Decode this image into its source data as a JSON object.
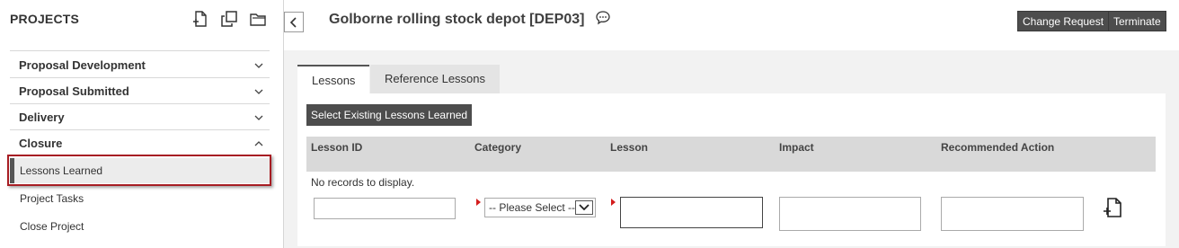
{
  "sidebar": {
    "header": "PROJECTS",
    "tools": [
      "new-page-icon",
      "copy-icon",
      "folder-icon"
    ],
    "sections": [
      {
        "label": "Proposal Development",
        "state": "collapsed"
      },
      {
        "label": "Proposal Submitted",
        "state": "collapsed"
      },
      {
        "label": "Delivery",
        "state": "collapsed"
      },
      {
        "label": "Closure",
        "state": "expanded"
      }
    ],
    "closure_items": [
      {
        "label": "Lessons Learned",
        "active": true
      },
      {
        "label": "Project Tasks",
        "active": false
      },
      {
        "label": "Close Project",
        "active": false
      }
    ]
  },
  "header": {
    "title": "Golborne rolling stock depot [DEP03]",
    "buttons": {
      "change_request": "Change Request",
      "terminate": "Terminate"
    }
  },
  "tabs": [
    {
      "label": "Lessons",
      "active": true
    },
    {
      "label": "Reference Lessons",
      "active": false
    }
  ],
  "panel": {
    "select_button": "Select Existing Lessons Learned",
    "columns": [
      "Lesson ID",
      "Category",
      "Lesson",
      "Impact",
      "Recommended Action"
    ],
    "empty_message": "No records to display.",
    "category_select": {
      "selected": "-- Please Select --"
    },
    "inputs": {
      "lesson_id": "",
      "lesson": "",
      "impact": "",
      "recommended_action": ""
    }
  },
  "colors": {
    "dark_button": "#4d4d4d",
    "highlight_border": "#a71d23",
    "required_marker": "#d41d1d",
    "grid_header": "#d9d9d9",
    "content_bg": "#f2f2f2"
  }
}
